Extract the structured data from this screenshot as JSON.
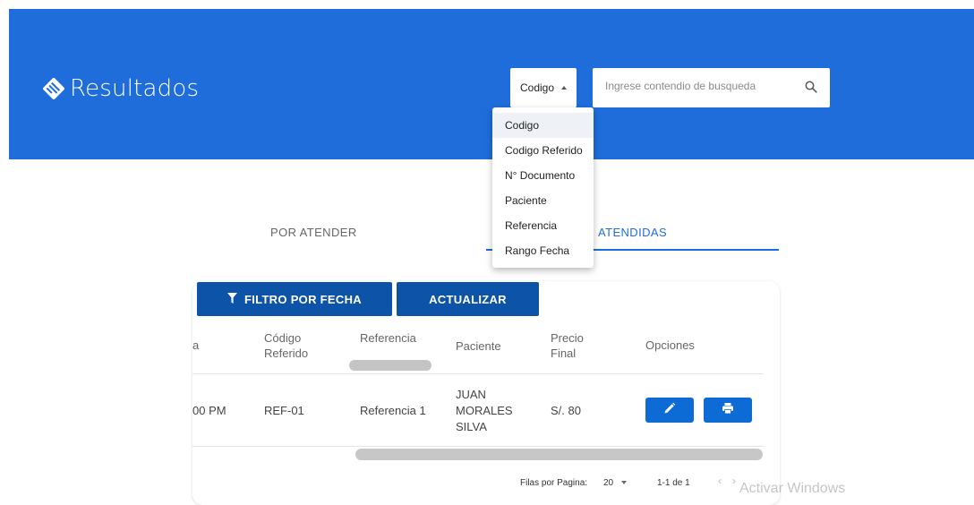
{
  "header": {
    "title": "Resultados",
    "logo_icon": "diamond-hand-logo-icon",
    "bg_color": "#1e6ddb"
  },
  "search": {
    "selected_field": "Codigo",
    "placeholder": "Ingrese contendio de busqueda",
    "value": "",
    "icon": "search-icon"
  },
  "dropdown": {
    "options": [
      "Codigo",
      "Codigo Referido",
      "N° Documento",
      "Paciente",
      "Referencia",
      "Rango Fecha"
    ]
  },
  "tabs": [
    {
      "label": "POR ATENDER",
      "active": false
    },
    {
      "label": "ATENDIDAS",
      "active": true
    }
  ],
  "toolbar": {
    "filter_label": "FILTRO POR FECHA",
    "refresh_label": "ACTUALIZAR",
    "filter_icon": "funnel-icon"
  },
  "table": {
    "headers": {
      "fecha_partial": "a",
      "codigo_referido": [
        "Código",
        "Referido"
      ],
      "referencia": "Referencia",
      "paciente": "Paciente",
      "precio_final": [
        "Precio",
        "Final"
      ],
      "opciones": "Opciones"
    },
    "rows": [
      {
        "fecha_partial": "00 PM",
        "codigo_referido": "REF-01",
        "referencia": "Referencia 1",
        "paciente": [
          "JUAN",
          "MORALES",
          "SILVA"
        ],
        "precio_final": "S/. 80",
        "actions": [
          "pencil-icon",
          "printer-icon"
        ]
      }
    ]
  },
  "pagination": {
    "rows_per_page_label": "Filas por Pagina:",
    "rows_per_page": "20",
    "range": "1-1 de 1"
  },
  "watermark": "Activar Windows",
  "colors": {
    "primary": "#1e6ddb",
    "button": "#0d53a8",
    "action_button": "#0d6bd6"
  }
}
